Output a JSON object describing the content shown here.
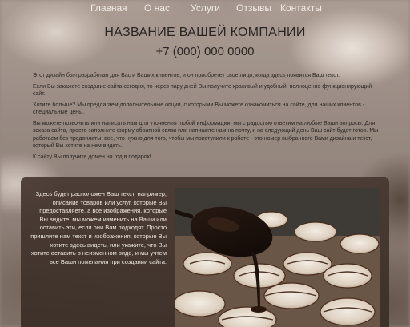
{
  "nav": {
    "items": [
      "Главная",
      "О нас",
      "Услуги",
      "Отзывы",
      "Контакты"
    ]
  },
  "header": {
    "company": "НАЗВАНИЕ ВАШЕЙ КОМПАНИИ",
    "phone": "+7 (000) 000 0000"
  },
  "main": {
    "paragraphs": [
      "Этот дизайн был разработан для Вас и Ваших клиентов, и он приобретет свое лицо, когда здесь появится Ваш текст.",
      "Если Вы закажете создание сайта сегодня, то через пару дней Вы получите красивый и удобный, полноценно функционирующий сайт.",
      "Хотите больше? Мы предлагаем дополнительные опции, с которыми Вы можете ознакомиться на сайте, для наших клиентов - специальные цены.",
      "Вы можете позвонить или написать нам для уточнения любой информации, мы с радостью ответим на любые Ваши вопросы. Для заказа сайта, просто заполните форму обратной связи или напишите нам на почту, и на следующий день Ваш сайт будет готов. Мы работаем без предоплаты, все, что нужно для того, чтобы мы приступили к работе - это номер выбранного Вами дизайна и текст, который Вы хотите на нем видеть.",
      "К сайту Вы получите домен на год в подарок!"
    ]
  },
  "feature": {
    "text": "Здесь будет расположен Ваш текст, например, описание товаров или услуг, которые Вы предоставляете, а все изображения, которые Вы видите, мы можем изменить на Ваши или оставить эти, если они Вам подходят. Просто пришлите нам текст и изображения, которые Вы хотите здесь видеть, или укажите, что Вы хотите оставить в неизменном виде, и мы учтем все Ваши пожелания при создании сайта."
  },
  "colors": {
    "nav_text": "#f2ece6",
    "heading_text": "#2a2522",
    "panel_bg": "#463830"
  },
  "icons": {
    "photo": "chocolate-spoon-cookies-photo"
  }
}
